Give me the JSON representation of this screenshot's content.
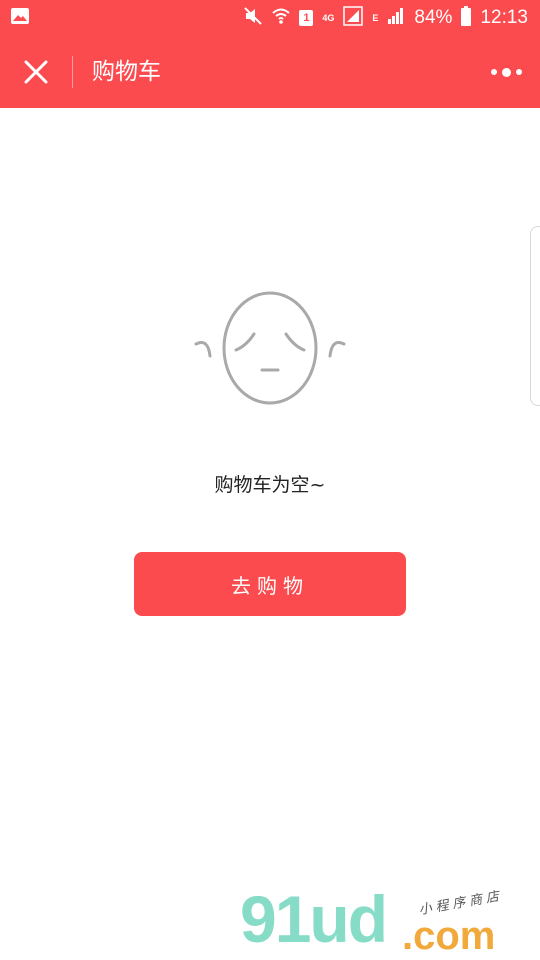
{
  "status_bar": {
    "battery": "84%",
    "time": "12:13",
    "network": "4G",
    "network_alt": "E",
    "sim_badge": "1"
  },
  "header": {
    "title": "购物车",
    "background": "#fb4b4f"
  },
  "empty_state": {
    "message": "购物车为空~",
    "face_icon": "sad-face-icon"
  },
  "actions": {
    "go_shopping_label": "去购物"
  },
  "watermark": {
    "brand": "91ud",
    "tld": ".com",
    "subtitle": "小程序商店"
  },
  "colors": {
    "accent": "#fb4b4f",
    "icon_gray": "#a9a9a9"
  }
}
